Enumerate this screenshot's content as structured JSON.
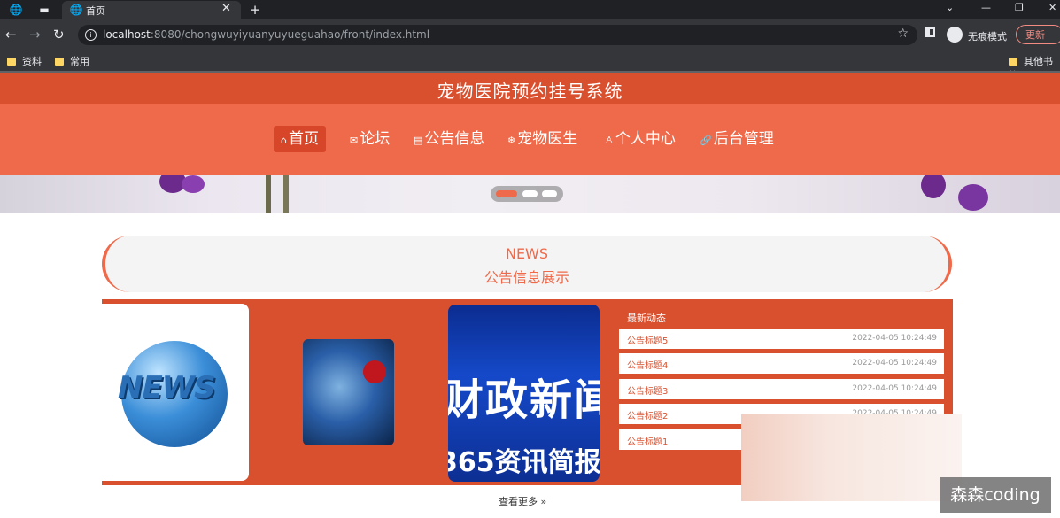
{
  "browser": {
    "tab_title": "首页",
    "url_host": "localhost",
    "url_rest": ":8080/chongwuyiyuanyuyueguahao/front/index.html",
    "incognito_label": "无痕模式",
    "update_label": "更新",
    "bookmarks": [
      "资料",
      "常用"
    ],
    "other_bookmarks": "其他书签"
  },
  "site": {
    "title": "宠物医院预约挂号系统",
    "nav": [
      {
        "label": "首页",
        "icon": "home-icon"
      },
      {
        "label": "论坛",
        "icon": "mail-icon"
      },
      {
        "label": "公告信息",
        "icon": "document-icon"
      },
      {
        "label": "宠物医生",
        "icon": "snowflake-icon"
      },
      {
        "label": "个人中心",
        "icon": "user-icon"
      },
      {
        "label": "后台管理",
        "icon": "link-icon"
      }
    ],
    "active_nav_index": 0,
    "carousel": {
      "slide_count": 3,
      "active_index": 0
    }
  },
  "news": {
    "heading_en": "NEWS",
    "heading_cn": "公告信息展示",
    "image1_text": "NEWS",
    "image3_text1": "财政新闻",
    "image3_text2": "365资讯简报",
    "latest_label": "最新动态",
    "items": [
      {
        "title": "公告标题5",
        "date": "2022-04-05 10:24:49"
      },
      {
        "title": "公告标题4",
        "date": "2022-04-05 10:24:49"
      },
      {
        "title": "公告标题3",
        "date": "2022-04-05 10:24:49"
      },
      {
        "title": "公告标题2",
        "date": "2022-04-05 10:24:49"
      },
      {
        "title": "公告标题1",
        "date": ""
      }
    ],
    "more_label": "查看更多"
  },
  "watermark": "森森coding",
  "colors": {
    "primary": "#ee6a4a",
    "primary_dark": "#d9502f"
  }
}
